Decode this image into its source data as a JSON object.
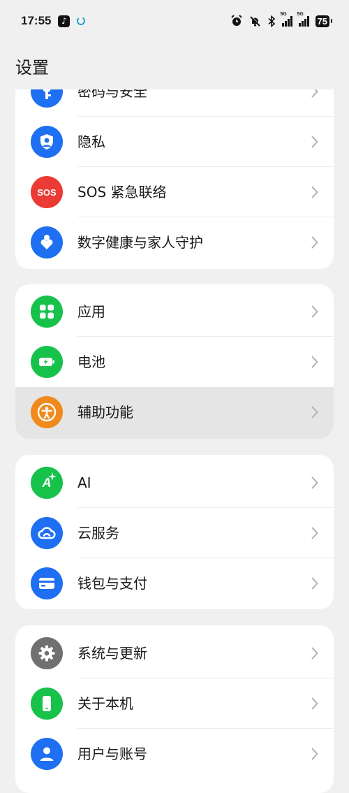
{
  "status_bar": {
    "time": "17:55",
    "battery": "75",
    "net1": "5G",
    "net2": "5G"
  },
  "page_title": "设置",
  "colors": {
    "blue": "#1f6ff2",
    "red": "#ec3a34",
    "green": "#17c24b",
    "orange": "#f08a1c",
    "gray": "#707070"
  },
  "groups": [
    {
      "items": [
        {
          "label": "密码与安全",
          "icon": "key-icon"
        },
        {
          "label": "隐私",
          "icon": "shield-person-icon"
        },
        {
          "label": "SOS 紧急联络",
          "icon": "sos-icon",
          "icon_text": "SOS"
        },
        {
          "label": "数字健康与家人守护",
          "icon": "person-heart-icon"
        }
      ]
    },
    {
      "items": [
        {
          "label": "应用",
          "icon": "apps-grid-icon"
        },
        {
          "label": "电池",
          "icon": "battery-icon"
        },
        {
          "label": "辅助功能",
          "icon": "accessibility-icon",
          "highlighted": true
        }
      ]
    },
    {
      "items": [
        {
          "label": "AI",
          "icon": "ai-sparkle-icon",
          "icon_text": "A"
        },
        {
          "label": "云服务",
          "icon": "cloud-icon"
        },
        {
          "label": "钱包与支付",
          "icon": "wallet-icon"
        }
      ]
    },
    {
      "items": [
        {
          "label": "系统与更新",
          "icon": "gear-icon"
        },
        {
          "label": "关于本机",
          "icon": "phone-icon"
        },
        {
          "label": "用户与账号",
          "icon": "user-icon"
        }
      ]
    }
  ]
}
